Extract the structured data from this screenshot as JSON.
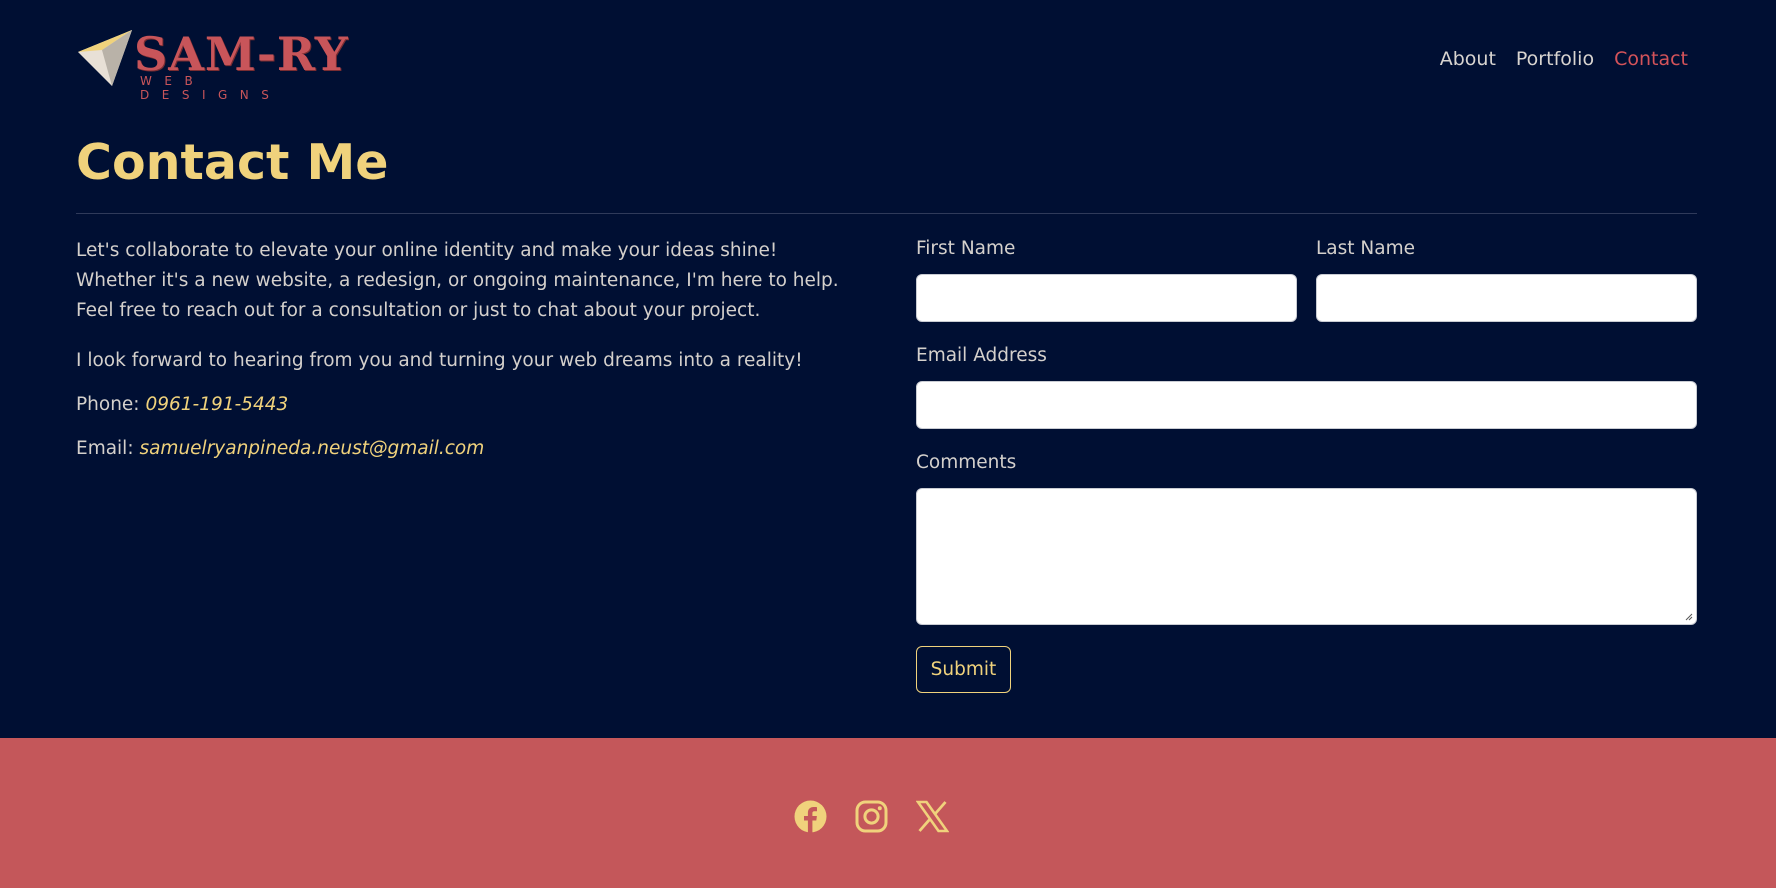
{
  "brand": {
    "name": "SAM-RY",
    "tagline": "WEB DESIGNS",
    "colors": {
      "red": "#c8555a",
      "gold": "#f0d27c",
      "navy": "#000f33"
    }
  },
  "nav": {
    "items": [
      {
        "label": "About",
        "active": false
      },
      {
        "label": "Portfolio",
        "active": false
      },
      {
        "label": "Contact",
        "active": true
      }
    ]
  },
  "main": {
    "title": "Contact Me",
    "intro": "Let's collaborate to elevate your online identity and make your ideas shine! Whether it's a new website, a redesign, or ongoing maintenance, I'm here to help. Feel free to reach out for a consultation or just to chat about your project.",
    "closing": "I look forward to hearing from you and turning your web dreams into a reality!",
    "phone_label": "Phone:",
    "phone": "0961-191-5443",
    "email_label": "Email:",
    "email": "samuelryanpineda.neust@gmail.com"
  },
  "form": {
    "first_name_label": "First Name",
    "first_name_value": "",
    "last_name_label": "Last Name",
    "last_name_value": "",
    "email_label": "Email Address",
    "email_value": "",
    "comments_label": "Comments",
    "comments_value": "",
    "submit_label": "Submit"
  },
  "footer": {
    "social": [
      "facebook-icon",
      "instagram-icon",
      "x-icon"
    ]
  }
}
